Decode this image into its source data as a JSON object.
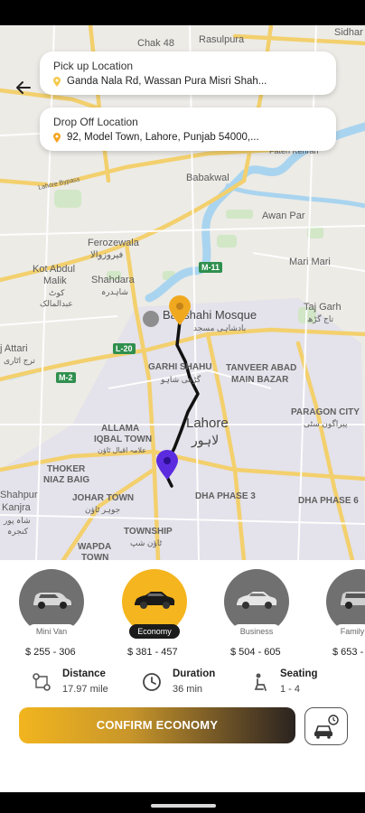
{
  "map": {
    "labels": {
      "chak48": "Chak 48",
      "rasulpura": "Rasulpura",
      "sidhar": "Sidhar",
      "babakwal": "Babakwal",
      "awan_par": "Awan Par",
      "ferozewala": "Ferozewala",
      "ferozewala_ur": "فیروزوالا",
      "kot_abdul_malik": "Kot Abdul",
      "kot_abdul_malik2": "Malik",
      "kot_ur": "کوٹ",
      "kot_ur2": "عبدالمالک",
      "shahdara": "Shahdara",
      "shahdara_ur": "شاہدرہ",
      "mari_mari": "Mari Mari",
      "taj_garh": "Taj Garh",
      "taj_garh_ur": "تاج گڑھ",
      "badshahi": "Badshahi Mosque",
      "badshahi_ur": "بادشاہی مسجد",
      "jattari": "j Attari",
      "jattari_ur": "ترج اٹاری",
      "garhi_shahu": "GARHI SHAHU",
      "garhi_ur": "گڑھی شاہو",
      "tanveer": "TANVEER ABAD",
      "main_bazar": "MAIN BAZAR",
      "paragon": "PARAGON CITY",
      "paragon_ur": "پیراگون سٹی",
      "lahore": "Lahore",
      "lahore_ur": "لاہور",
      "allama1": "ALLAMA",
      "allama2": "IQBAL TOWN",
      "allama_ur": "علامہ اقبال ٹاؤن",
      "thoker1": "THOKER",
      "thoker2": "NIAZ BAIG",
      "shahpur1": "Shahpur",
      "shahpur2": "Kanjra",
      "shahpur_ur": "شاہ پور",
      "shahpur_ur2": "کنجرہ",
      "johar": "JOHAR TOWN",
      "johar_ur": "جوہر ٹاؤن",
      "dha3": "DHA PHASE 3",
      "dha6": "DHA PHASE 6",
      "township": "TOWNSHIP",
      "township_ur": "ٹاؤن شپ",
      "wapda1": "WAPDA",
      "wapda2": "TOWN",
      "patti": "Fateh Kehran",
      "bypass": "Lahore Bypass"
    },
    "shields": {
      "m11": "M-11",
      "l20": "L-20",
      "m2": "M-2"
    }
  },
  "pickup": {
    "title": "Pick up Location",
    "value": "Ganda Nala Rd, Wassan Pura Misri Shah..."
  },
  "dropoff": {
    "title": "Drop Off Location",
    "value": "92, Model Town, Lahore, Punjab 54000,..."
  },
  "vehicles": [
    {
      "name": "Mini Van",
      "price": "$ 255 - 306",
      "selected": false
    },
    {
      "name": "Economy",
      "price": "$ 381 - 457",
      "selected": true
    },
    {
      "name": "Business",
      "price": "$ 504 - 605",
      "selected": false
    },
    {
      "name": "Family",
      "price": "$ 653 -",
      "selected": false
    }
  ],
  "trip": {
    "distance_label": "Distance",
    "distance_value": "17.97 mile",
    "duration_label": "Duration",
    "duration_value": "36 min",
    "seating_label": "Seating",
    "seating_value": "1 - 4"
  },
  "confirm": {
    "label": "CONFIRM ECONOMY"
  },
  "colors": {
    "accent": "#f5b51e",
    "pickup_pin": "#f0a91e",
    "dropoff_pin": "#5b2be0",
    "route": "#111111",
    "river": "#a9d4ef"
  }
}
